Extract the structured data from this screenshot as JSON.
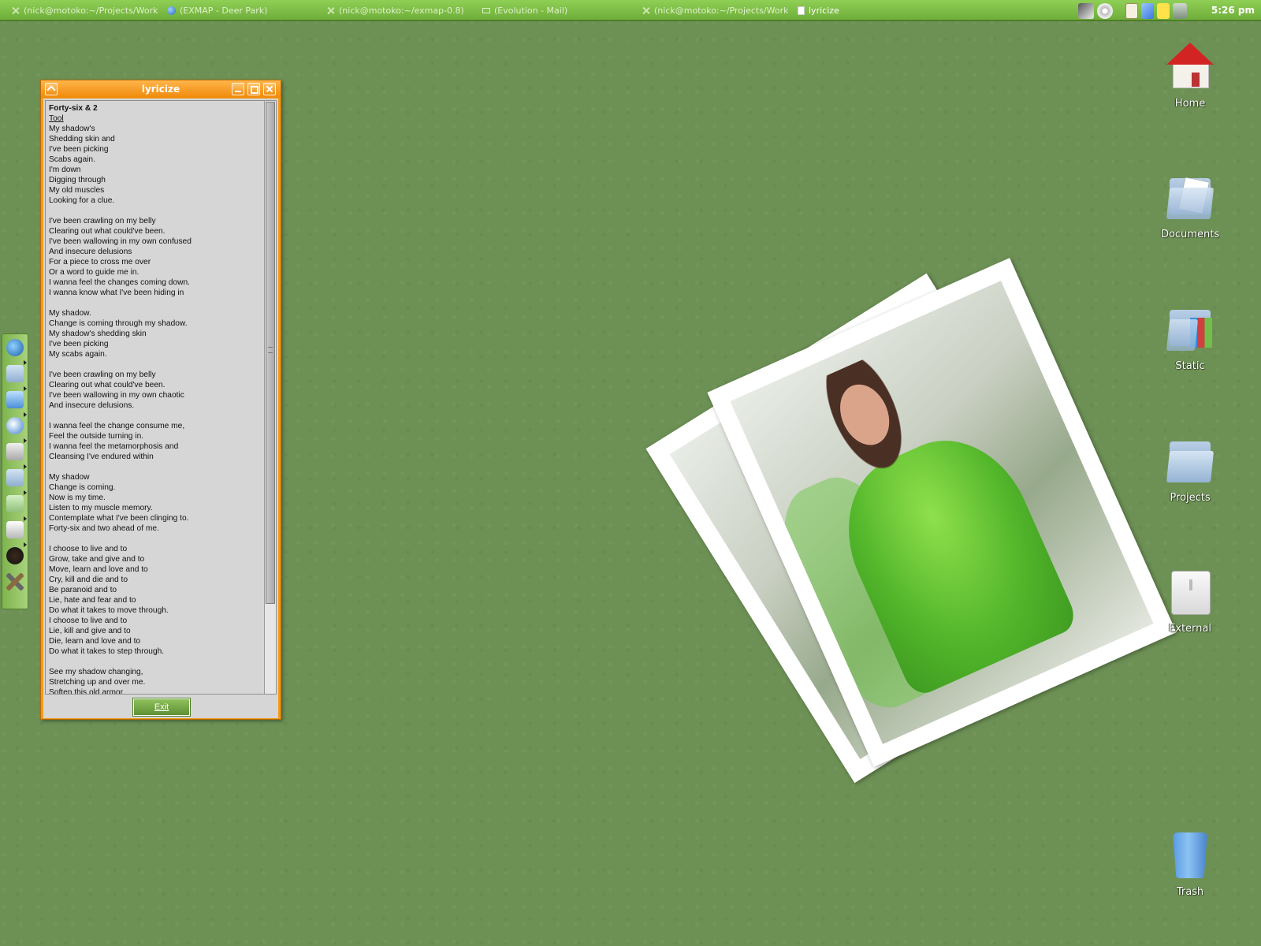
{
  "taskbar": {
    "tasks": [
      {
        "label": "(nick@motoko:~/Projects/Workspa",
        "icon": "terminal-icon"
      },
      {
        "label": "(EXMAP - Deer Park)",
        "icon": "globe-icon"
      },
      {
        "label": "(nick@motoko:~/exmap-0.8)",
        "icon": "terminal-icon"
      },
      {
        "label": "(Evolution - Mail)",
        "icon": "mail-icon"
      },
      {
        "label": "(nick@motoko:~/Projects/Workspa",
        "icon": "terminal-icon"
      },
      {
        "label": "lyricize",
        "icon": "document-icon"
      }
    ],
    "tray_icons": [
      "network-icon",
      "cd-icon",
      "clipboard-icon",
      "pencil-icon",
      "notes-icon",
      "monitor-icon"
    ],
    "clock": "5:26 pm"
  },
  "dock": {
    "items": [
      "globe-icon",
      "folder-icon",
      "mail-icon",
      "browser-icon",
      "drive-icon",
      "music-icon",
      "folder-icon",
      "trash-icon",
      "gnome-icon",
      "tools-icon"
    ]
  },
  "window": {
    "title": "lyricize",
    "song_title": "Forty-six & 2",
    "artist": "Tool",
    "lyrics": "My shadow's\nShedding skin and\nI've been picking\nScabs again.\nI'm down\nDigging through\nMy old muscles\nLooking for a clue.\n\nI've been crawling on my belly\nClearing out what could've been.\nI've been wallowing in my own confused\nAnd insecure delusions\nFor a piece to cross me over\nOr a word to guide me in.\nI wanna feel the changes coming down.\nI wanna know what I've been hiding in\n\nMy shadow.\nChange is coming through my shadow.\nMy shadow's shedding skin\nI've been picking\nMy scabs again.\n\nI've been crawling on my belly\nClearing out what could've been.\nI've been wallowing in my own chaotic\nAnd insecure delusions.\n\nI wanna feel the change consume me,\nFeel the outside turning in.\nI wanna feel the metamorphosis and\nCleansing I've endured within\n\nMy shadow\nChange is coming.\nNow is my time.\nListen to my muscle memory.\nContemplate what I've been clinging to.\nForty-six and two ahead of me.\n\nI choose to live and to\nGrow, take and give and to\nMove, learn and love and to\nCry, kill and die and to\nBe paranoid and to\nLie, hate and fear and to\nDo what it takes to move through.\nI choose to live and to\nLie, kill and give and to\nDie, learn and love and to\nDo what it takes to step through.\n\nSee my shadow changing,\nStretching up and over me.\nSoften this old armor",
    "exit_label": "Exit"
  },
  "desktop_icons": [
    {
      "label": "Home",
      "icon": "home-icon"
    },
    {
      "label": "Documents",
      "icon": "documents-folder-icon"
    },
    {
      "label": "Static",
      "icon": "static-folder-icon"
    },
    {
      "label": "Projects",
      "icon": "projects-folder-icon"
    },
    {
      "label": "External",
      "icon": "external-drive-icon"
    },
    {
      "label": "Trash",
      "icon": "trash-icon"
    }
  ],
  "colors": {
    "desktop_bg": "#6d9155",
    "taskbar": "#7fbf48",
    "window_frame": "#f29a1a",
    "exit_button": "#6fa142"
  }
}
